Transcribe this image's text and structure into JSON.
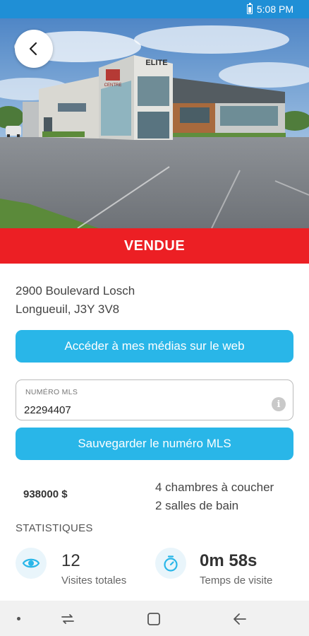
{
  "status_bar": {
    "time": "5:08 PM",
    "battery_icon": "battery-icon"
  },
  "header": {
    "back_icon": "chevron-left-icon"
  },
  "hero": {
    "sign_left": "CENTRE",
    "sign_right": "ELITE"
  },
  "listing": {
    "status": "VENDUE",
    "status_color": "#ec1f24",
    "address_line1": "2900 Boulevard Losch",
    "address_line2": "Longueuil, J3Y 3V8",
    "price": "938000 $",
    "bedrooms": "4 chambres à coucher",
    "bathrooms": "2 salles de bain"
  },
  "actions": {
    "web_media_label": "Accéder à mes médias sur le web",
    "save_mls_label": "Sauvegarder le numéro MLS",
    "accent_color": "#29b6e8"
  },
  "mls": {
    "label": "NUMÉRO MLS",
    "value": "22294407",
    "info_icon": "info-icon"
  },
  "stats": {
    "heading": "STATISTIQUES",
    "visits": {
      "value": "12",
      "label": "Visites totales",
      "icon": "eye-icon"
    },
    "visit_time": {
      "value": "0m 58s",
      "label": "Temps de visite",
      "icon": "timer-icon"
    }
  },
  "nav": {
    "recents_icon": "recents-icon",
    "home_icon": "home-icon",
    "back_icon": "back-arrow-icon"
  }
}
